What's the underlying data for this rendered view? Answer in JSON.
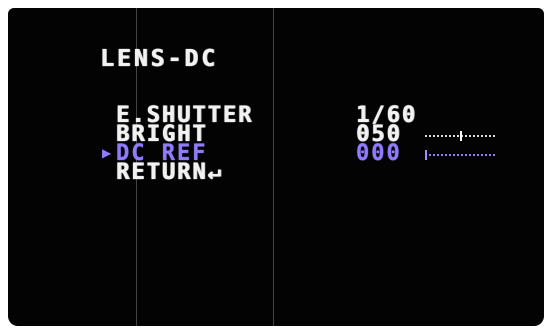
{
  "menu": {
    "title": "LENS-DC",
    "items": [
      {
        "label": "E.SHUTTER",
        "value": "1/60",
        "selected": false
      },
      {
        "label": "BRIGHT",
        "value": "050",
        "level": 0.5,
        "selected": false
      },
      {
        "label": "DC REF",
        "value": "000",
        "level": 0.0,
        "selected": true
      },
      {
        "label": "RETURN↵",
        "selected": false
      }
    ],
    "cursor_icon": "triangle-right-icon"
  },
  "colors": {
    "background": "#030303",
    "text": "#f2f2f2",
    "selected": "#8e7bff"
  }
}
